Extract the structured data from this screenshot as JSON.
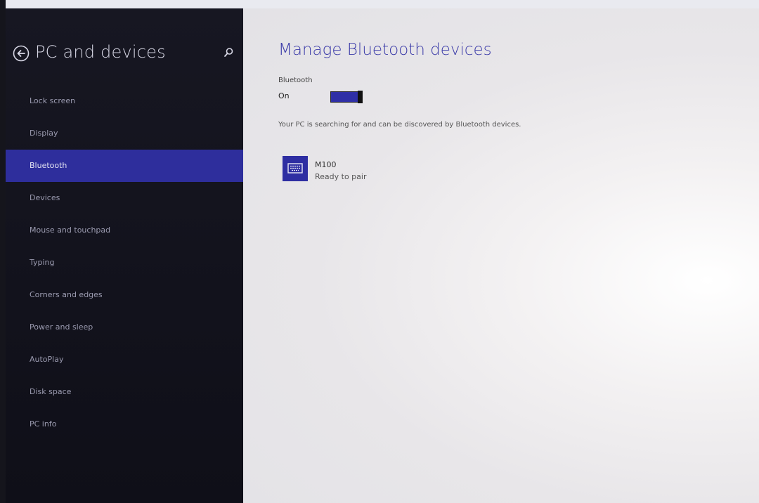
{
  "nav": {
    "title": "PC and devices",
    "back_icon": "back-arrow-circle-icon",
    "search_icon": "search-icon",
    "items": [
      {
        "label": "Lock screen",
        "active": false
      },
      {
        "label": "Display",
        "active": false
      },
      {
        "label": "Bluetooth",
        "active": true
      },
      {
        "label": "Devices",
        "active": false
      },
      {
        "label": "Mouse and touchpad",
        "active": false
      },
      {
        "label": "Typing",
        "active": false
      },
      {
        "label": "Corners and edges",
        "active": false
      },
      {
        "label": "Power and sleep",
        "active": false
      },
      {
        "label": "AutoPlay",
        "active": false
      },
      {
        "label": "Disk space",
        "active": false
      },
      {
        "label": "PC info",
        "active": false
      }
    ]
  },
  "main": {
    "title": "Manage Bluetooth devices",
    "bluetooth_label": "Bluetooth",
    "toggle_state": "On",
    "toggle_on": true,
    "status_text": "Your PC is searching for and can be discovered by Bluetooth devices.",
    "devices": [
      {
        "name": "M100",
        "status": "Ready to pair",
        "icon": "keyboard-icon"
      }
    ]
  },
  "colors": {
    "accent": "#2e2e9c",
    "nav_background": "#14141e",
    "title_color": "#3a3aa8",
    "content_background": "#ececf0"
  }
}
